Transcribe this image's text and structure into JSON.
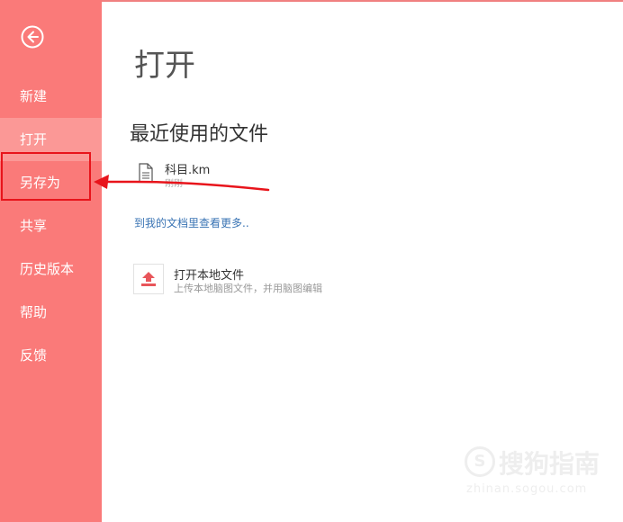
{
  "sidebar": {
    "items": [
      {
        "label": "新建"
      },
      {
        "label": "打开",
        "active": true
      },
      {
        "label": "另存为"
      },
      {
        "label": "共享"
      },
      {
        "label": "历史版本"
      },
      {
        "label": "帮助"
      },
      {
        "label": "反馈"
      }
    ],
    "back_icon": "arrow-left-circle-icon"
  },
  "main": {
    "title": "打开",
    "recent_title": "最近使用的文件",
    "recent_files": [
      {
        "name": "科目.km",
        "sub": "刚刚",
        "icon": "document-icon"
      }
    ],
    "more_link": "到我的文档里查看更多..",
    "open_local": {
      "label": "打开本地文件",
      "sub": "上传本地脑图文件，并用脑图编辑",
      "icon": "upload-icon"
    }
  },
  "watermark": {
    "logo": "S",
    "text": "搜狗指南",
    "url": "zhinan.sogou.com"
  },
  "colors": {
    "sidebar_bg": "#fa7a79",
    "sidebar_active": "#fb9896",
    "annotation_red": "#e8141b",
    "link_blue": "#3a74b4",
    "upload_red": "#e8555a"
  }
}
